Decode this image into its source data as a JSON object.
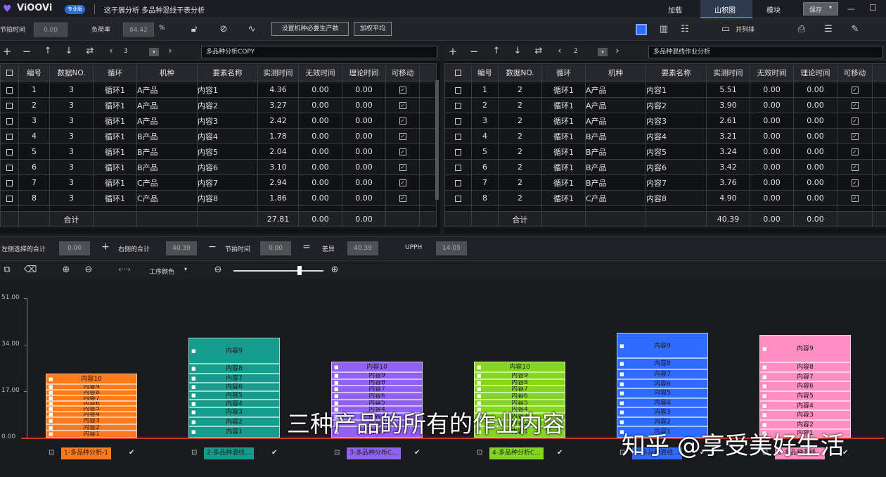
{
  "app": {
    "logo": "ViOOVi",
    "badge": "专业版",
    "doc_title": "这于展分析 多品种混线干表分析"
  },
  "nav": {
    "items": [
      "加载",
      "山积图",
      "模块",
      "保存"
    ],
    "active": 1
  },
  "toolbar": {
    "beat_label": "节拍时间",
    "beat_value": "0.00",
    "load_label": "负荷率",
    "load_value": "84.42",
    "load_unit": "%",
    "btn_set": "设置机种必要生产数",
    "btn_weighted": "加权平均",
    "layout_label": "并列排"
  },
  "left_pane": {
    "page": "3",
    "title": "多品种分析COPY",
    "columns": [
      "编号",
      "数据NO.",
      "循环",
      "机种",
      "要素名称",
      "实测时间",
      "无效时间",
      "理论时间",
      "可移动"
    ],
    "rows": [
      [
        "1",
        "3",
        "循环1",
        "A产品",
        "内容1",
        "4.36",
        "0.00",
        "0.00"
      ],
      [
        "2",
        "3",
        "循环1",
        "A产品",
        "内容2",
        "3.27",
        "0.00",
        "0.00"
      ],
      [
        "3",
        "3",
        "循环1",
        "A产品",
        "内容3",
        "2.42",
        "0.00",
        "0.00"
      ],
      [
        "4",
        "3",
        "循环1",
        "B产品",
        "内容4",
        "1.78",
        "0.00",
        "0.00"
      ],
      [
        "5",
        "3",
        "循环1",
        "B产品",
        "内容5",
        "2.04",
        "0.00",
        "0.00"
      ],
      [
        "6",
        "3",
        "循环1",
        "B产品",
        "内容6",
        "3.10",
        "0.00",
        "0.00"
      ],
      [
        "7",
        "3",
        "循环1",
        "C产品",
        "内容7",
        "2.94",
        "0.00",
        "0.00"
      ],
      [
        "8",
        "3",
        "循环1",
        "C产品",
        "内容8",
        "1.86",
        "0.00",
        "0.00"
      ]
    ],
    "total_label": "合计",
    "total": [
      "27.81",
      "0.00",
      "0.00"
    ]
  },
  "right_pane": {
    "page": "2",
    "title": "多品种混线作业分析",
    "columns": [
      "编号",
      "数据NO.",
      "循环",
      "机种",
      "要素名称",
      "实测时间",
      "无效时间",
      "理论时间",
      "可移动"
    ],
    "rows": [
      [
        "1",
        "2",
        "循环1",
        "A产品",
        "内容1",
        "5.51",
        "0.00",
        "0.00"
      ],
      [
        "2",
        "2",
        "循环1",
        "A产品",
        "内容2",
        "3.90",
        "0.00",
        "0.00"
      ],
      [
        "3",
        "2",
        "循环1",
        "A产品",
        "内容3",
        "2.61",
        "0.00",
        "0.00"
      ],
      [
        "4",
        "2",
        "循环1",
        "B产品",
        "内容4",
        "3.21",
        "0.00",
        "0.00"
      ],
      [
        "5",
        "2",
        "循环1",
        "B产品",
        "内容5",
        "3.24",
        "0.00",
        "0.00"
      ],
      [
        "6",
        "2",
        "循环1",
        "B产品",
        "内容6",
        "3.42",
        "0.00",
        "0.00"
      ],
      [
        "7",
        "2",
        "循环1",
        "B产品",
        "内容7",
        "3.76",
        "0.00",
        "0.00"
      ],
      [
        "8",
        "2",
        "循环1",
        "C产品",
        "内容8",
        "4.90",
        "0.00",
        "0.00"
      ]
    ],
    "total_label": "合计",
    "total": [
      "40.39",
      "0.00",
      "0.00"
    ]
  },
  "summary": {
    "left_label": "左侧选择的合计",
    "left_value": "0.00",
    "right_label": "右侧的合计",
    "right_value": "40.39",
    "beat_label": "节拍时间",
    "beat_value": "0.00",
    "diff_label": "差异",
    "diff_value": "40.39",
    "upph_label": "UPPH",
    "upph_value": "14.05"
  },
  "chart_toolbar": {
    "color_mode": "工序颜色"
  },
  "chart_data": {
    "type": "bar",
    "stacked": true,
    "ylim": [
      0,
      51
    ],
    "yticks": [
      "0.00",
      "17.00",
      "34.00",
      "51.00"
    ],
    "stacks": [
      {
        "name": "1-多品种分析-1",
        "color": "#ff7a18",
        "blocks": [
          {
            "label": "内容1",
            "value": 2.5
          },
          {
            "label": "内容2",
            "value": 2.5
          },
          {
            "label": "内容3",
            "value": 2.5
          },
          {
            "label": "内容4",
            "value": 2
          },
          {
            "label": "内容5",
            "value": 2
          },
          {
            "label": "内容6",
            "value": 2
          },
          {
            "label": "内容7",
            "value": 2
          },
          {
            "label": "内容8",
            "value": 2
          },
          {
            "label": "内容9",
            "value": 2
          },
          {
            "label": "内容10",
            "value": 4.0
          }
        ]
      },
      {
        "name": "2-多品种混线...",
        "color": "#179b8c",
        "blocks": [
          {
            "label": "内容1",
            "value": 4
          },
          {
            "label": "内容2",
            "value": 3.5
          },
          {
            "label": "内容3",
            "value": 3.5
          },
          {
            "label": "内容4",
            "value": 3
          },
          {
            "label": "内容5",
            "value": 3
          },
          {
            "label": "内容6",
            "value": 3
          },
          {
            "label": "内容7",
            "value": 3.5
          },
          {
            "label": "内容8",
            "value": 3.5
          },
          {
            "label": "内容9",
            "value": 9.5
          }
        ]
      },
      {
        "name": "3-多品种分析C...",
        "color": "#8f62f0",
        "blocks": [
          {
            "label": "内容1",
            "value": 4
          },
          {
            "label": "内容2",
            "value": 2.5
          },
          {
            "label": "内容3",
            "value": 2.5
          },
          {
            "label": "内容4",
            "value": 2.5
          },
          {
            "label": "内容5",
            "value": 2.5
          },
          {
            "label": "内容6",
            "value": 2.5
          },
          {
            "label": "内容7",
            "value": 2.5
          },
          {
            "label": "内容8",
            "value": 2.5
          },
          {
            "label": "内容9",
            "value": 2.5
          },
          {
            "label": "内容10",
            "value": 3.8
          }
        ]
      },
      {
        "name": "4-多品种分析C...",
        "color": "#85d620",
        "blocks": [
          {
            "label": "内容1",
            "value": 4
          },
          {
            "label": "内容2",
            "value": 2.5
          },
          {
            "label": "内容3",
            "value": 2.5
          },
          {
            "label": "内容4",
            "value": 2.5
          },
          {
            "label": "内容5",
            "value": 2.5
          },
          {
            "label": "内容6",
            "value": 2.5
          },
          {
            "label": "内容7",
            "value": 2.5
          },
          {
            "label": "内容8",
            "value": 2.5
          },
          {
            "label": "内容9",
            "value": 2.5
          },
          {
            "label": "内容10",
            "value": 3.8
          }
        ]
      },
      {
        "name": "5-多品种混线...",
        "color": "#2f6bff",
        "blocks": [
          {
            "label": "内容1",
            "value": 4
          },
          {
            "label": "内容2",
            "value": 3.5
          },
          {
            "label": "内容3",
            "value": 3.5
          },
          {
            "label": "内容4",
            "value": 3.5
          },
          {
            "label": "内容5",
            "value": 3.5
          },
          {
            "label": "内容6",
            "value": 3.5
          },
          {
            "label": "内容7",
            "value": 3.5
          },
          {
            "label": "内容8",
            "value": 4
          },
          {
            "label": "内容9",
            "value": 9.5
          }
        ]
      },
      {
        "name": "6-多品种混线...",
        "color": "#ff8ec2",
        "blocks": [
          {
            "label": "内容1",
            "value": 3
          },
          {
            "label": "内容2",
            "value": 3.5
          },
          {
            "label": "内容3",
            "value": 3.5
          },
          {
            "label": "内容4",
            "value": 3.5
          },
          {
            "label": "内容5",
            "value": 3.5
          },
          {
            "label": "内容6",
            "value": 3.5
          },
          {
            "label": "内容7",
            "value": 3.5
          },
          {
            "label": "内容8",
            "value": 3.5
          },
          {
            "label": "内容9",
            "value": 10
          }
        ]
      }
    ]
  },
  "overlay": {
    "subtitle": "三种产品的所有的作业内容",
    "watermark": "知乎 @享受美好生活"
  }
}
